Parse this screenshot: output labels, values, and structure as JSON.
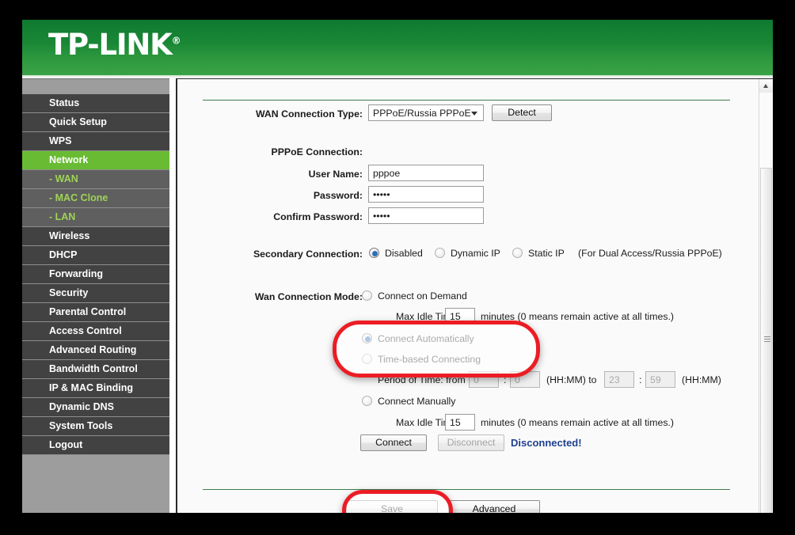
{
  "brand": {
    "logo_text": "TP-LINK",
    "registered_mark": "®"
  },
  "colors": {
    "banner_green": "#1a8736",
    "accent_green": "#68bb32",
    "submenu_green": "#9ed356",
    "highlight_red": "#ec1c24",
    "status_blue": "#1f3f8f",
    "divider_green": "#3c7d4e"
  },
  "sidebar": {
    "items": [
      {
        "label": "Status",
        "state": "normal"
      },
      {
        "label": "Quick Setup",
        "state": "normal"
      },
      {
        "label": "WPS",
        "state": "normal"
      },
      {
        "label": "Network",
        "state": "active"
      },
      {
        "label": "- WAN",
        "state": "sub-selected"
      },
      {
        "label": "- MAC Clone",
        "state": "sub"
      },
      {
        "label": "- LAN",
        "state": "sub"
      },
      {
        "label": "Wireless",
        "state": "normal"
      },
      {
        "label": "DHCP",
        "state": "normal"
      },
      {
        "label": "Forwarding",
        "state": "normal"
      },
      {
        "label": "Security",
        "state": "normal"
      },
      {
        "label": "Parental Control",
        "state": "normal"
      },
      {
        "label": "Access Control",
        "state": "normal"
      },
      {
        "label": "Advanced Routing",
        "state": "normal"
      },
      {
        "label": "Bandwidth Control",
        "state": "normal"
      },
      {
        "label": "IP & MAC Binding",
        "state": "normal"
      },
      {
        "label": "Dynamic DNS",
        "state": "normal"
      },
      {
        "label": "System Tools",
        "state": "normal"
      },
      {
        "label": "Logout",
        "state": "normal"
      }
    ]
  },
  "form": {
    "wan_type_label": "WAN Connection Type:",
    "wan_type_value": "PPPoE/Russia PPPoE",
    "detect_button": "Detect",
    "pppoe_section_label": "PPPoE Connection:",
    "username_label": "User Name:",
    "username_value": "pppoe",
    "password_label": "Password:",
    "password_value": "•••••",
    "confirm_password_label": "Confirm Password:",
    "confirm_password_value": "•••••",
    "secondary_label": "Secondary Connection:",
    "secondary_options": [
      {
        "label": "Disabled",
        "selected": true
      },
      {
        "label": "Dynamic IP",
        "selected": false
      },
      {
        "label": "Static IP",
        "selected": false
      }
    ],
    "secondary_note": "(For Dual Access/Russia PPPoE)",
    "wan_mode_label": "Wan Connection Mode:",
    "mode_connect_on_demand": "Connect on Demand",
    "mode_demand_idle_label": "Max Idle Time:",
    "mode_demand_idle_value": "15",
    "mode_demand_idle_suffix": "minutes (0 means remain active at all times.)",
    "mode_connect_automatically": "Connect Automatically",
    "mode_time_based": "Time-based Connecting",
    "period_label": "Period of Time: from",
    "period_from_hh": "0",
    "period_colon": ":",
    "period_from_mm": "0",
    "period_hhmm_1": "(HH:MM) to",
    "period_to_hh": "23",
    "period_to_mm": "59",
    "period_hhmm_2": "(HH:MM)",
    "mode_connect_manually": "Connect Manually",
    "manual_idle_label": "Max Idle Time:",
    "manual_idle_value": "15",
    "manual_idle_suffix": "minutes (0 means remain active at all times.)",
    "connect_button": "Connect",
    "disconnect_button": "Disconnect",
    "status_text": "Disconnected!",
    "save_button": "Save",
    "advanced_button": "Advanced"
  },
  "annotations": {
    "highlight_1": "Connect Automatically radio option",
    "highlight_2": "Save button"
  }
}
